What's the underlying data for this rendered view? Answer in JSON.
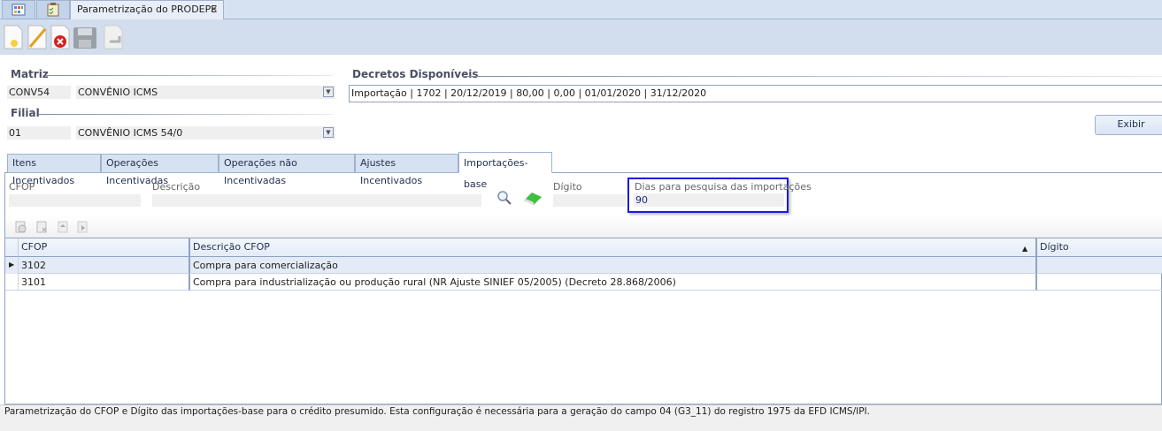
{
  "window_tabs": [
    {
      "icon": "grid-icon"
    },
    {
      "icon": "checklist-icon"
    },
    {
      "label": "Parametrização do PRODEPE",
      "close": "✕"
    }
  ],
  "toolbar": [
    {
      "name": "new-button",
      "icon": "new-document-icon"
    },
    {
      "name": "edit-button",
      "icon": "pencil-icon"
    },
    {
      "name": "delete-button",
      "icon": "delete-icon"
    },
    {
      "name": "save-button",
      "icon": "save-icon"
    },
    {
      "name": "undo-button",
      "icon": "undo-icon"
    }
  ],
  "matriz": {
    "label": "Matriz",
    "code": "CONV54",
    "name": "CONVÊNIO ICMS"
  },
  "filial": {
    "label": "Filial",
    "code": "01",
    "name": "CONVÊNIO ICMS 54/0"
  },
  "decretos": {
    "label": "Decretos Disponíveis",
    "value": "Importação | 1702 | 20/12/2019 | 80,00 | 0,00 | 01/01/2020 | 31/12/2020"
  },
  "exibir_label": "Exibir",
  "tabs": [
    "Itens Incentivados",
    "Operações Incentivadas",
    "Operações não Incentivadas",
    "Ajustes Incentivados",
    "Importações-base"
  ],
  "form": {
    "cfop_label": "CFOP",
    "cfop_value": "",
    "descricao_label": "Descrição",
    "descricao_value": "",
    "digito_label": "Dígito",
    "digito_value": "",
    "dias_label": "Dias para pesquisa das importações",
    "dias_value": "90"
  },
  "grid": {
    "columns": [
      "CFOP",
      "Descrição CFOP",
      "Dígito"
    ],
    "rows": [
      {
        "cfop": "3102",
        "descricao": "Compra para comercialização",
        "digito": ""
      },
      {
        "cfop": "3101",
        "descricao": "Compra para industrialização ou produção rural (NR Ajuste SINIEF 05/2005) (Decreto 28.868/2006)",
        "digito": ""
      }
    ]
  },
  "status": "Parametrização do CFOP e Dígito das importações-base para o crédito presumido. Esta configuração é necessária para a geração do campo 04 (G3_11) do registro 1975 da EFD ICMS/IPI."
}
